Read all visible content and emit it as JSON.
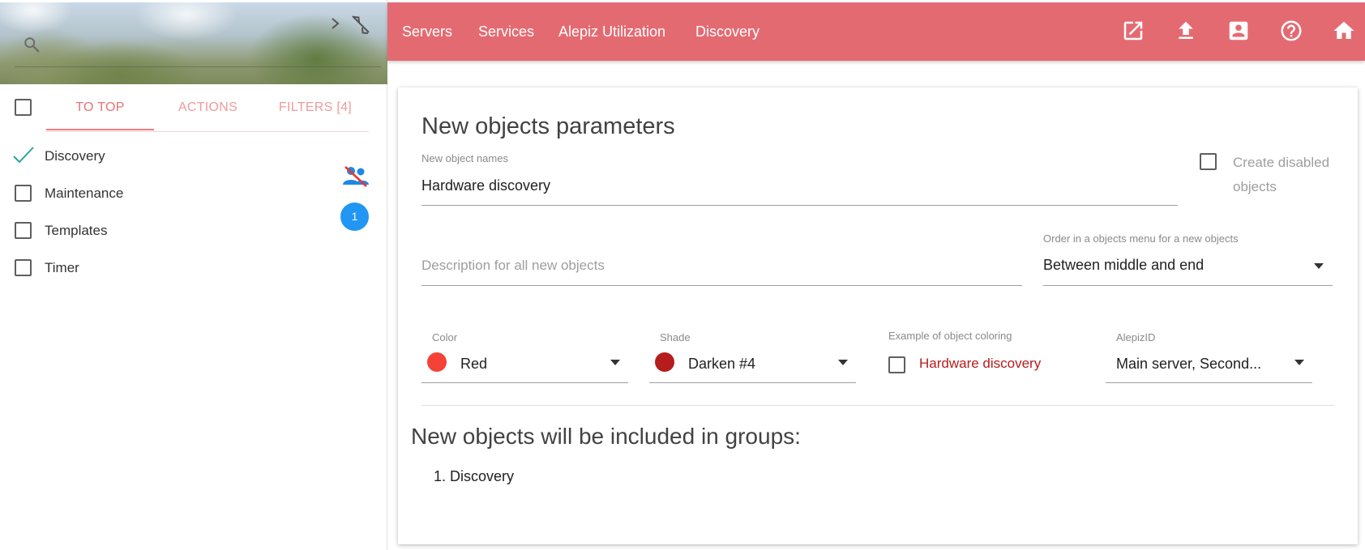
{
  "sidebar": {
    "tabs": [
      {
        "label": "TO TOP"
      },
      {
        "label": "ACTIONS"
      },
      {
        "label": "FILTERS [4]"
      }
    ],
    "objects": [
      {
        "label": "Discovery",
        "checked": true
      },
      {
        "label": "Maintenance",
        "checked": false
      },
      {
        "label": "Templates",
        "checked": false
      },
      {
        "label": "Timer",
        "checked": false
      }
    ],
    "badge_count": "1",
    "accent_color": "#e46a72",
    "badge_color": "#2196f3"
  },
  "topnav": {
    "links": [
      {
        "label": "Servers"
      },
      {
        "label": "Services"
      },
      {
        "label": "Alepiz Utilization"
      },
      {
        "label": "Discovery"
      }
    ],
    "icons": [
      "open-in-new-icon",
      "upload-icon",
      "account-box-icon",
      "help-icon",
      "home-icon"
    ]
  },
  "form": {
    "title": "New objects parameters",
    "names": {
      "label": "New object names",
      "value": "Hardware discovery"
    },
    "create_disabled": {
      "label": "Create disabled objects",
      "checked": false
    },
    "description": {
      "placeholder": "Description for all new objects"
    },
    "order": {
      "label": "Order in a objects menu for a new objects",
      "value": "Between middle and end"
    },
    "color": {
      "label": "Color",
      "value": "Red",
      "swatch": "#f44336"
    },
    "shade": {
      "label": "Shade",
      "value": "Darken #4",
      "swatch": "#b71c1c"
    },
    "example": {
      "label": "Example of object coloring",
      "text": "Hardware discovery"
    },
    "alepiz_id": {
      "label": "AlepizID",
      "value": "Main server, Second..."
    },
    "groups_title": "New objects will be included in groups:",
    "groups": [
      "1. Discovery"
    ]
  }
}
